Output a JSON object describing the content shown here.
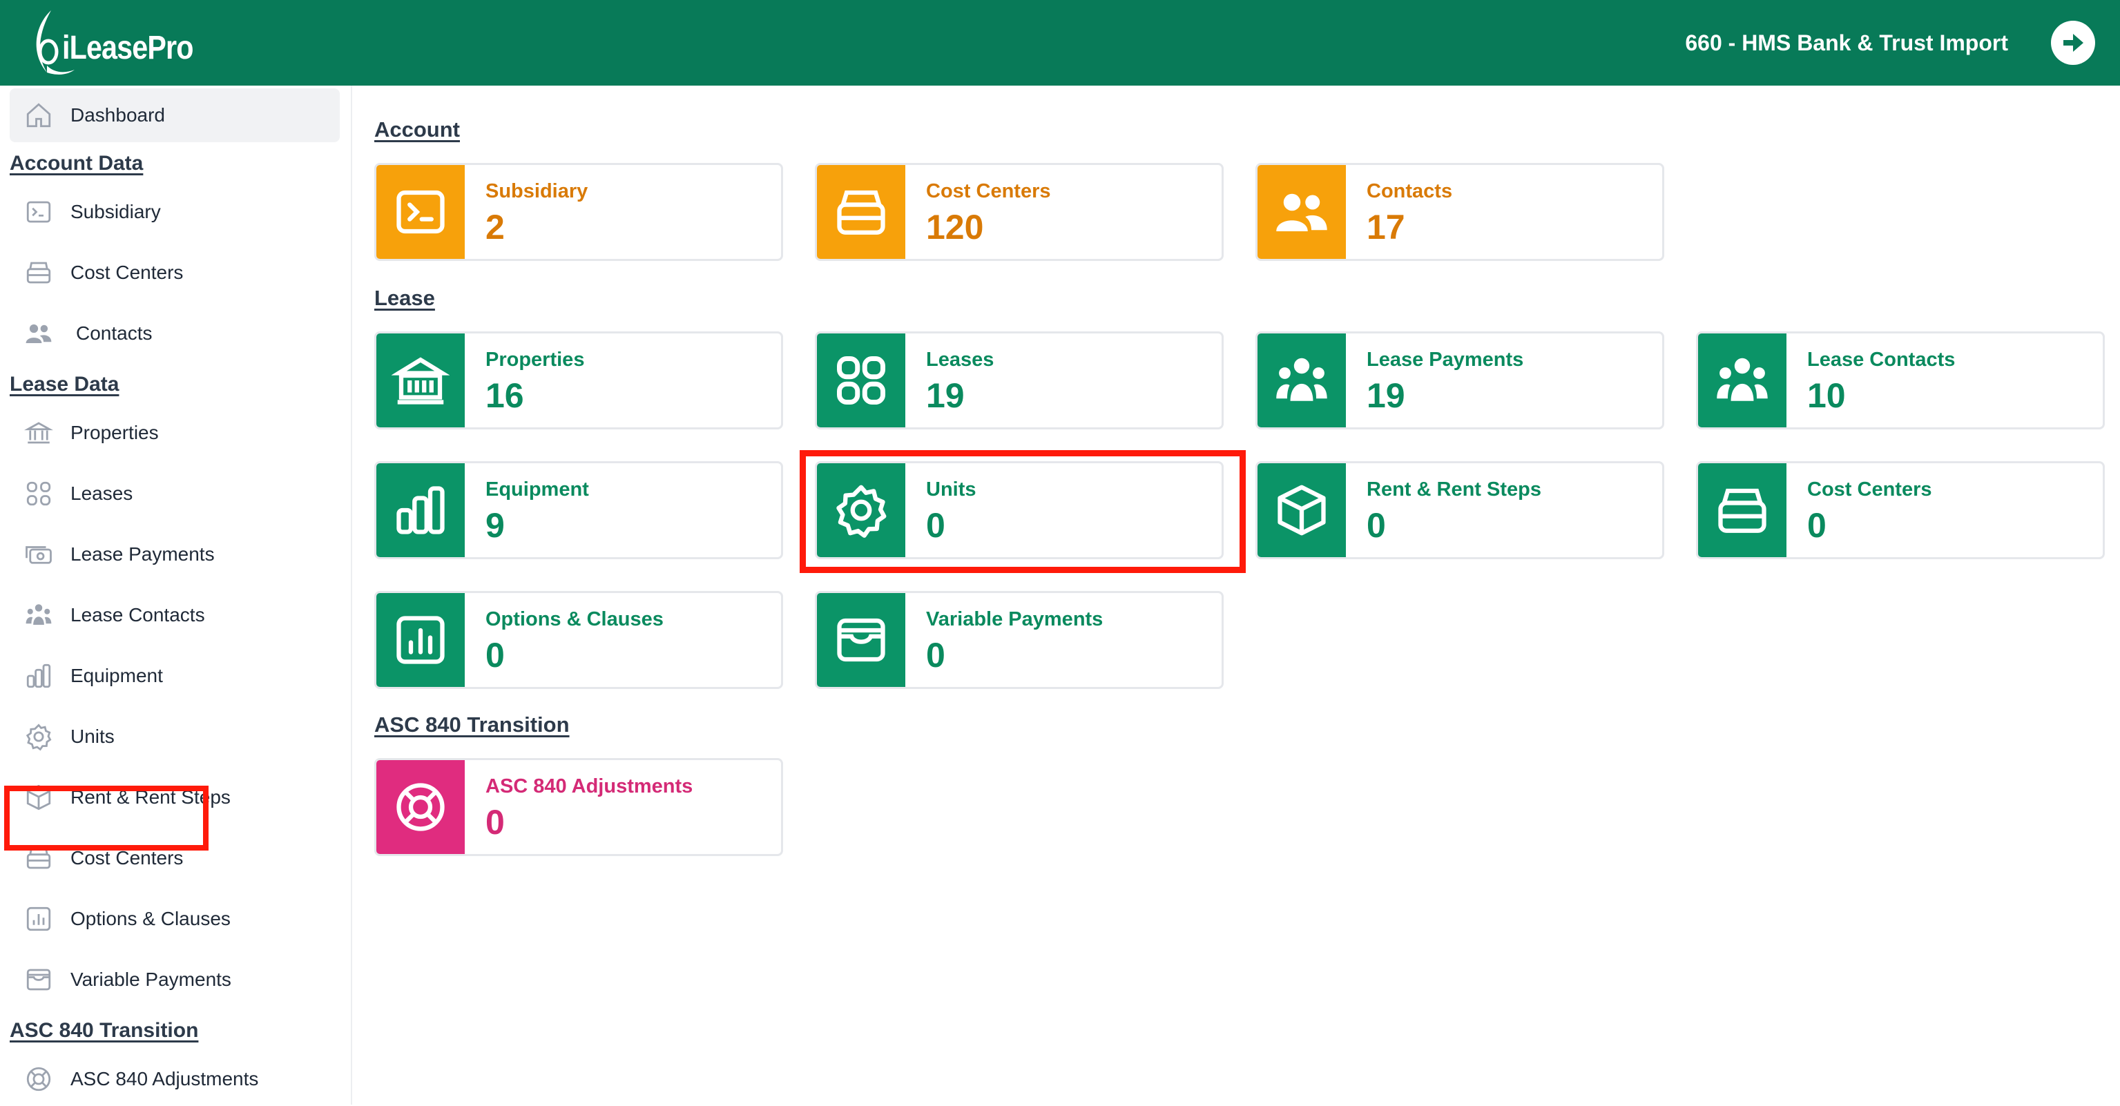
{
  "app": {
    "logo_text": "iLeasePro",
    "account_title": "660 - HMS Bank & Trust Import"
  },
  "sidebar": {
    "dashboard": "Dashboard",
    "account_heading": "Account Data",
    "account_items": [
      "Subsidiary",
      "Cost Centers",
      "Contacts"
    ],
    "lease_heading": "Lease Data",
    "lease_items": [
      "Properties",
      "Leases",
      "Lease Payments",
      "Lease Contacts",
      "Equipment",
      "Units",
      "Rent & Rent Steps",
      "Cost Centers",
      "Options & Clauses",
      "Variable Payments"
    ],
    "asc_heading": "ASC 840 Transition",
    "asc_items": [
      "ASC 840 Adjustments"
    ]
  },
  "main": {
    "account_heading": "Account",
    "lease_heading": "Lease",
    "asc_heading": "ASC 840 Transition",
    "account_cards": [
      {
        "label": "Subsidiary",
        "count": "2"
      },
      {
        "label": "Cost Centers",
        "count": "120"
      },
      {
        "label": "Contacts",
        "count": "17"
      }
    ],
    "lease_cards": [
      {
        "label": "Properties",
        "count": "16"
      },
      {
        "label": "Leases",
        "count": "19"
      },
      {
        "label": "Lease Payments",
        "count": "19"
      },
      {
        "label": "Lease Contacts",
        "count": "10"
      },
      {
        "label": "Equipment",
        "count": "9"
      },
      {
        "label": "Units",
        "count": "0"
      },
      {
        "label": "Rent & Rent Steps",
        "count": "0"
      },
      {
        "label": "Cost Centers",
        "count": "0"
      },
      {
        "label": "Options & Clauses",
        "count": "0"
      },
      {
        "label": "Variable Payments",
        "count": "0"
      }
    ],
    "asc_cards": [
      {
        "label": "ASC 840 Adjustments",
        "count": "0"
      }
    ]
  },
  "colors": {
    "brand_green": "#087a58",
    "orange": "#f7a10b",
    "green": "#0b9467",
    "pink": "#e02c7f",
    "highlight": "#ff1a0a"
  },
  "icons": {
    "subsidiary": "terminal-icon",
    "cost_centers": "inbox-stack-icon",
    "contacts": "users-icon",
    "properties": "bank-building-icon",
    "leases": "grid-icon",
    "lease_payments": "user-group-icon",
    "lease_contacts": "user-group-icon",
    "equipment": "bar-chart-icon",
    "units": "gear-icon",
    "rent_steps": "cube-icon",
    "options_clauses": "chart-square-icon",
    "variable_payments": "wallet-icon",
    "asc_adjustments": "lifebuoy-icon"
  }
}
